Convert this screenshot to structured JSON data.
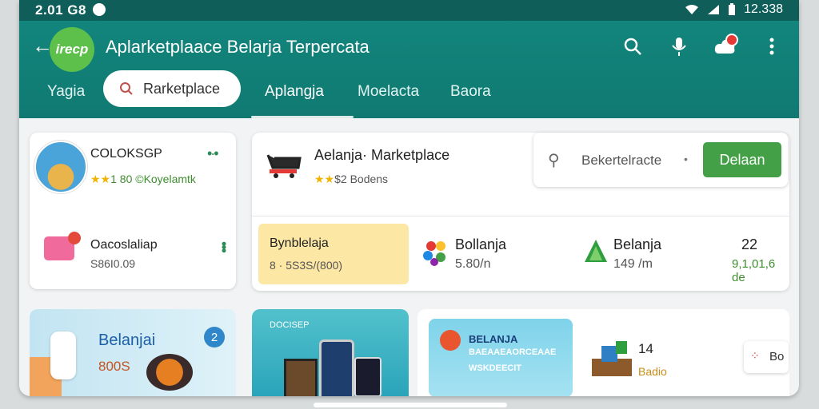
{
  "status_bar": {
    "time_left": "2.01 G8",
    "time_right": "12.338",
    "icons": [
      "wifi-icon",
      "signal-icon",
      "battery-icon"
    ]
  },
  "app_bar": {
    "logo_text": "irecp",
    "title": "Aplarketplaace Belarja Terpercata",
    "icons": [
      "search-icon",
      "microphone-icon",
      "cloud-notification-icon",
      "more-vert-icon"
    ],
    "accent": "#128a80"
  },
  "tabs": {
    "first": "Yagia",
    "search_pill": "Rarketplace",
    "items": [
      "Aplangja",
      "Moelacta",
      "Baora"
    ]
  },
  "left_card": {
    "seller_name": "COLOKSGP",
    "rating_stars": "★★",
    "rating_text": "1 80 ©Koyelamtk",
    "item_title": "Oacoslaliap",
    "item_price": "S86I0.09"
  },
  "main_card": {
    "title": "Aelanja· Marketplace",
    "rating_stars": "★★",
    "rating_text": "$2 Bodens",
    "search": {
      "placeholder": "Bekertelracte",
      "dot": "•",
      "button": "Delaan"
    },
    "tiles": [
      {
        "title": "Bynblelaja",
        "price": "8 · 5S3S/(800)"
      },
      {
        "title": "Bollanja",
        "price": "5.80/n"
      },
      {
        "title": "Belanja",
        "price": "149 /m"
      },
      {
        "title": "22",
        "price": "9,1,01,6 de"
      }
    ]
  },
  "bottom_banners": {
    "b1_title": "Belanjai",
    "b1_price": "800S",
    "b1_badge": "2",
    "b2_text": "DOCISEP",
    "b3_title": "BELANJA",
    "b3_sub": "BAEAAEAORCEAAE",
    "b3_sub2": "WSKDEECIT",
    "b3_count": "14",
    "b3_label": "Badio",
    "b3_mini": "Bo"
  },
  "colors": {
    "green_button": "#43a047",
    "teal": "#128a80",
    "yellow_tile": "#fde7a5"
  }
}
